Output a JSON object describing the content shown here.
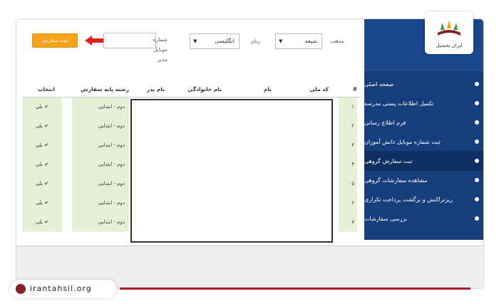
{
  "logo": {
    "text": "ایران تحصیل"
  },
  "site": {
    "url": "irantahsil.org"
  },
  "toolbar": {
    "submit_button": "ثبت سفارش",
    "mobile_label_1": "شماره",
    "mobile_label_2": "موبایل",
    "mobile_label_3": "مدیر",
    "language_label": "زبان",
    "language_value": "انگلیسی",
    "religion_label": "مذهب",
    "religion_value": "شیعه"
  },
  "sidebar": {
    "items": [
      {
        "label": "صفحه اصلی"
      },
      {
        "label": "تکمیل اطلاعات پستی مدرسه"
      },
      {
        "label": "فرم اطلاع رسانی"
      },
      {
        "label": "ثبت شماره موبایل دانش آموزان"
      },
      {
        "label": "ثبت سفارش گروهی"
      },
      {
        "label": "مشاهده سفارشات گروهی"
      },
      {
        "label": "ریزتراکنش و برگشت پرداخت تکراری"
      },
      {
        "label": "بررسی سفارشات"
      }
    ]
  },
  "table": {
    "headers": [
      "#",
      "کد ملی",
      "نام",
      "نام خانوادگی",
      "نام پدر",
      "رشته پایه سفارش",
      "انتخاب"
    ],
    "rows": [
      {
        "num": "۱",
        "grade": "دوم - ابتدایی",
        "select": "✔ بلی"
      },
      {
        "num": "۲",
        "grade": "دوم - ابتدایی",
        "select": "✔ بلی"
      },
      {
        "num": "۳",
        "grade": "دوم - ابتدایی",
        "select": "✔ بلی"
      },
      {
        "num": "۴",
        "grade": "دوم - ابتدایی",
        "select": "✔ بلی"
      },
      {
        "num": "۵",
        "grade": "دوم - ابتدایی",
        "select": "✔ بلی"
      },
      {
        "num": "۶",
        "grade": "دوم - ابتدایی",
        "select": "✔ بلی"
      },
      {
        "num": "۷",
        "grade": "دوم - ابتدایی",
        "select": "✔ بلی"
      }
    ]
  },
  "colors": {
    "sidebar": "#173e7c",
    "accent": "#f5a21d",
    "arrow": "#e02020"
  }
}
